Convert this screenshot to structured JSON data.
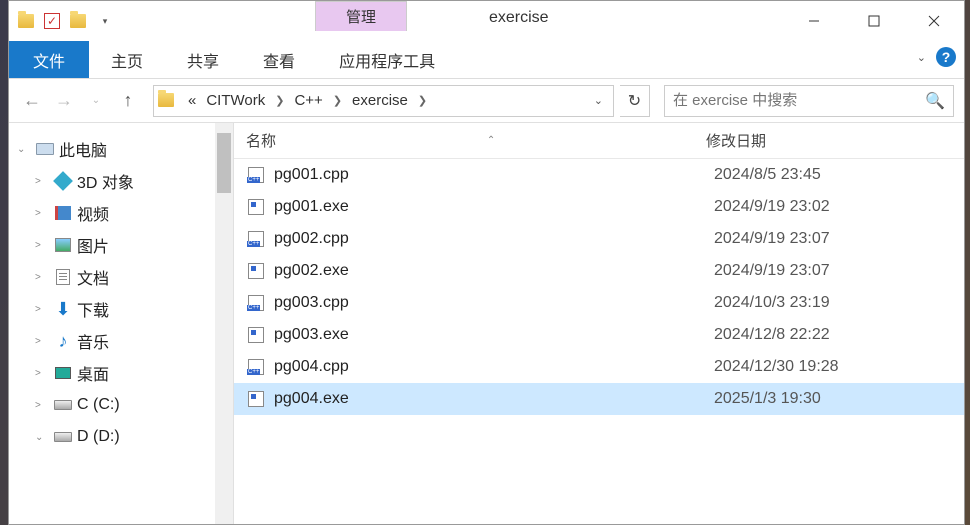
{
  "window": {
    "title": "exercise",
    "context_tab": "管理",
    "context_sub": "应用程序工具"
  },
  "ribbon": {
    "file": "文件",
    "tabs": [
      "主页",
      "共享",
      "查看"
    ]
  },
  "breadcrumb": {
    "prefix": "«",
    "segments": [
      "CITWork",
      "C++",
      "exercise"
    ]
  },
  "search": {
    "placeholder": "在 exercise 中搜索"
  },
  "nav_tree": {
    "root": "此电脑",
    "items": [
      {
        "label": "3D 对象",
        "icon": "cube"
      },
      {
        "label": "视频",
        "icon": "video"
      },
      {
        "label": "图片",
        "icon": "pic"
      },
      {
        "label": "文档",
        "icon": "doc"
      },
      {
        "label": "下载",
        "icon": "download"
      },
      {
        "label": "音乐",
        "icon": "music"
      },
      {
        "label": "桌面",
        "icon": "desktop"
      },
      {
        "label": "C (C:)",
        "icon": "drive"
      },
      {
        "label": "D (D:)",
        "icon": "drive",
        "expanded": true
      }
    ]
  },
  "columns": {
    "name": "名称",
    "date": "修改日期"
  },
  "files": [
    {
      "name": "pg001.cpp",
      "type": "cpp",
      "date": "2024/8/5 23:45"
    },
    {
      "name": "pg001.exe",
      "type": "exe",
      "date": "2024/9/19 23:02"
    },
    {
      "name": "pg002.cpp",
      "type": "cpp",
      "date": "2024/9/19 23:07"
    },
    {
      "name": "pg002.exe",
      "type": "exe",
      "date": "2024/9/19 23:07"
    },
    {
      "name": "pg003.cpp",
      "type": "cpp",
      "date": "2024/10/3 23:19"
    },
    {
      "name": "pg003.exe",
      "type": "exe",
      "date": "2024/12/8 22:22"
    },
    {
      "name": "pg004.cpp",
      "type": "cpp",
      "date": "2024/12/30 19:28"
    },
    {
      "name": "pg004.exe",
      "type": "exe",
      "date": "2025/1/3 19:30",
      "selected": true
    }
  ]
}
